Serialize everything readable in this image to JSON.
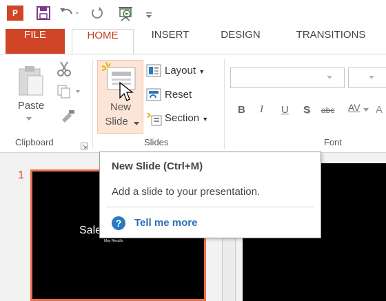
{
  "colors": {
    "accent": "#d04525",
    "link": "#2b6fb6",
    "help": "#2b79c2",
    "newslide_bg": "#fce4d6",
    "thumb_border": "#e8704b"
  },
  "titlebar": {
    "app_logo": "P",
    "qat_icons": [
      "save-icon",
      "undo-icon",
      "redo-icon",
      "slideshow-icon",
      "customize-icon"
    ]
  },
  "tabs": [
    {
      "label": "FILE"
    },
    {
      "label": "HOME"
    },
    {
      "label": "INSERT"
    },
    {
      "label": "DESIGN"
    },
    {
      "label": "TRANSITIONS"
    }
  ],
  "ribbon": {
    "clipboard": {
      "paste": "Paste",
      "group": "Clipboard"
    },
    "slides": {
      "new_slide_line1": "New",
      "new_slide_line2": "Slide",
      "layout": "Layout",
      "reset": "Reset",
      "section": "Section",
      "group": "Slides"
    },
    "font": {
      "bold": "B",
      "italic": "I",
      "underline": "U",
      "shadow": "S",
      "strike": "abc",
      "spacing": "AV",
      "group": "Font"
    }
  },
  "thumbnails": {
    "number": "1",
    "title": "Sale",
    "subtitle": "May Results"
  },
  "tooltip": {
    "title": "New Slide (Ctrl+M)",
    "description": "Add a slide to your presentation.",
    "link": "Tell me more",
    "help_glyph": "?"
  }
}
